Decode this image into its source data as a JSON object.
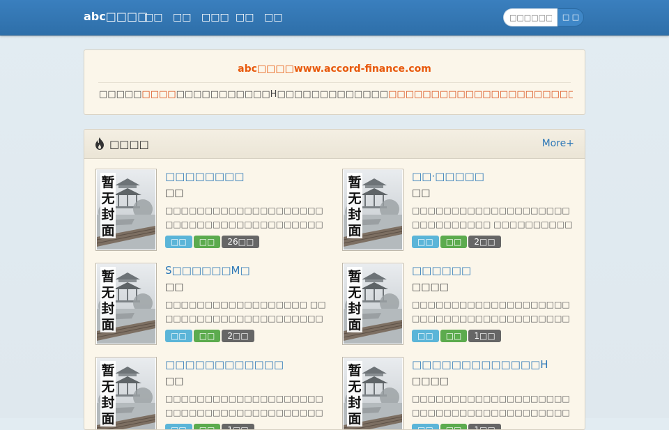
{
  "navbar": {
    "brand": "abc□□□□",
    "items": [
      "□□",
      "□□",
      "□□□",
      "□□",
      "□□"
    ],
    "search_placeholder": "□□□□□□□□",
    "search_button": "□ □"
  },
  "info": {
    "title": "abc□□□□www.accord-finance.com",
    "text_before": "□□□□□",
    "text_hl1": "□□□□",
    "text_mid": "□□□□□□□□□□□H□□□□□□□□□□□□□",
    "text_hl2": "□□□□□□□□□□□□□□□□□□□□□□□□□□□□□□□□",
    "text_after": "□□□□□□□□□"
  },
  "hot": {
    "title": "□□□□",
    "more": "More+",
    "books": [
      {
        "title": "□□□□□□□□",
        "author": "□□",
        "desc": "□□□□□□□□□□□□□□□□□□□□□□□□□□□□□□□□□□□□□□□□□□□□□□□□",
        "tag1": "□□",
        "tag2": "□□",
        "tag3": "26□□"
      },
      {
        "title": "□□·□□□□□",
        "author": "□□",
        "desc": "□□□□□□□□□□□□□□□□□□□□□□□□□□□□□□ □□□□□□□□□□□□□□□□□□□□□□□□□□",
        "tag1": "□□",
        "tag2": "□□",
        "tag3": "2□□"
      },
      {
        "title": "S□□□□□□M□",
        "author": "□□",
        "desc": "□□□□□□□□□□□□□□□□□□ □□□□□□□□□□□□□□□□□□□□□□□□□□□□□□□□□jj□□□□□□□ □□□□□□",
        "tag1": "□□",
        "tag2": "□□",
        "tag3": "2□□"
      },
      {
        "title": "□□□□□□",
        "author": "□□□□",
        "desc": "□□□□□□□□□□□□□□□□□□□□□□□□□□□□□□□□□□□□□□□□□□□□□□□□□□□□□□□□□□",
        "tag1": "□□",
        "tag2": "□□",
        "tag3": "1□□"
      },
      {
        "title": "□□□□□□□□□□□□",
        "author": "□□",
        "desc": "□□□□□□□□□□□□□□□□□□□□□□□□□□□□□□□□□□□□□□□□□□□□ □□□□□□□□□□□□□",
        "tag1": "□□",
        "tag2": "□□",
        "tag3": "1□□"
      },
      {
        "title": "□□□□□□□□□□□□□H",
        "author": "□□□□",
        "desc": "□□□□□□□□□□□□□□□□□□□□□□□□□□□□□□□□□□□□□□□□□□□□□□□□□□□□□□□□□□",
        "tag1": "□□",
        "tag2": "□□",
        "tag3": "1□□"
      }
    ]
  },
  "cover_placeholder": [
    "暂",
    "无",
    "封",
    "面"
  ],
  "colors": {
    "navbar": "#2e6fa9",
    "link": "#2f79b8",
    "highlight": "#e8590c",
    "tag_blue": "#5bb5d8",
    "tag_green": "#5cab4e",
    "tag_gray": "#666666"
  }
}
